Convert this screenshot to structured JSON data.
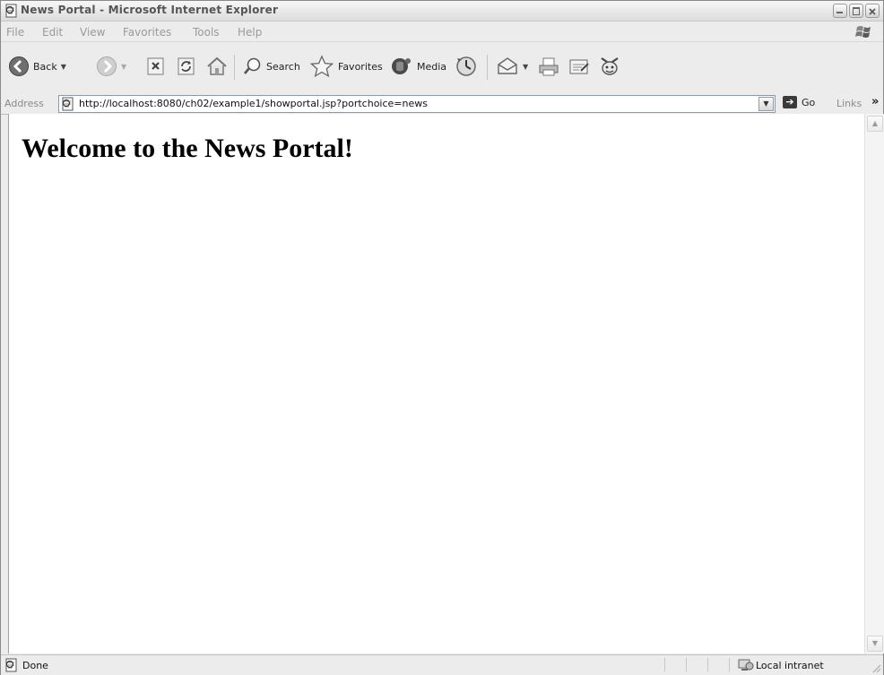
{
  "window": {
    "title": "News Portal - Microsoft Internet Explorer"
  },
  "menu": [
    "File",
    "Edit",
    "View",
    "Favorites",
    "Tools",
    "Help"
  ],
  "toolbar": {
    "back_label": "Back",
    "search_label": "Search",
    "favorites_label": "Favorites",
    "media_label": "Media"
  },
  "address": {
    "label": "Address",
    "url": "http://localhost:8080/ch02/example1/showportal.jsp?portchoice=news",
    "go_label": "Go",
    "links_label": "Links"
  },
  "page": {
    "heading": "Welcome to the News Portal!"
  },
  "status": {
    "text": "Done",
    "zone": "Local intranet"
  }
}
